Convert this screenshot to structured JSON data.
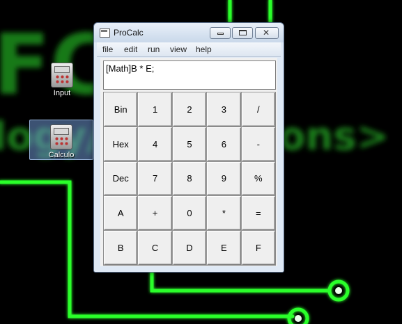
{
  "desktop": {
    "wallpaper_color": "#000000",
    "accent_green": "#2bff2b",
    "icons": [
      {
        "label": "Input",
        "selected": false
      },
      {
        "label": "Calculo",
        "selected": true
      }
    ]
  },
  "window": {
    "title": "ProCalc",
    "menu": [
      "file",
      "edit",
      "run",
      "view",
      "help"
    ],
    "display_text": "[Math]B * E;",
    "keys": [
      [
        "Bin",
        "1",
        "2",
        "3",
        "/"
      ],
      [
        "Hex",
        "4",
        "5",
        "6",
        "-"
      ],
      [
        "Dec",
        "7",
        "8",
        "9",
        "%"
      ],
      [
        "A",
        "+",
        "0",
        "*",
        "="
      ],
      [
        "B",
        "C",
        "D",
        "E",
        "F"
      ]
    ]
  }
}
